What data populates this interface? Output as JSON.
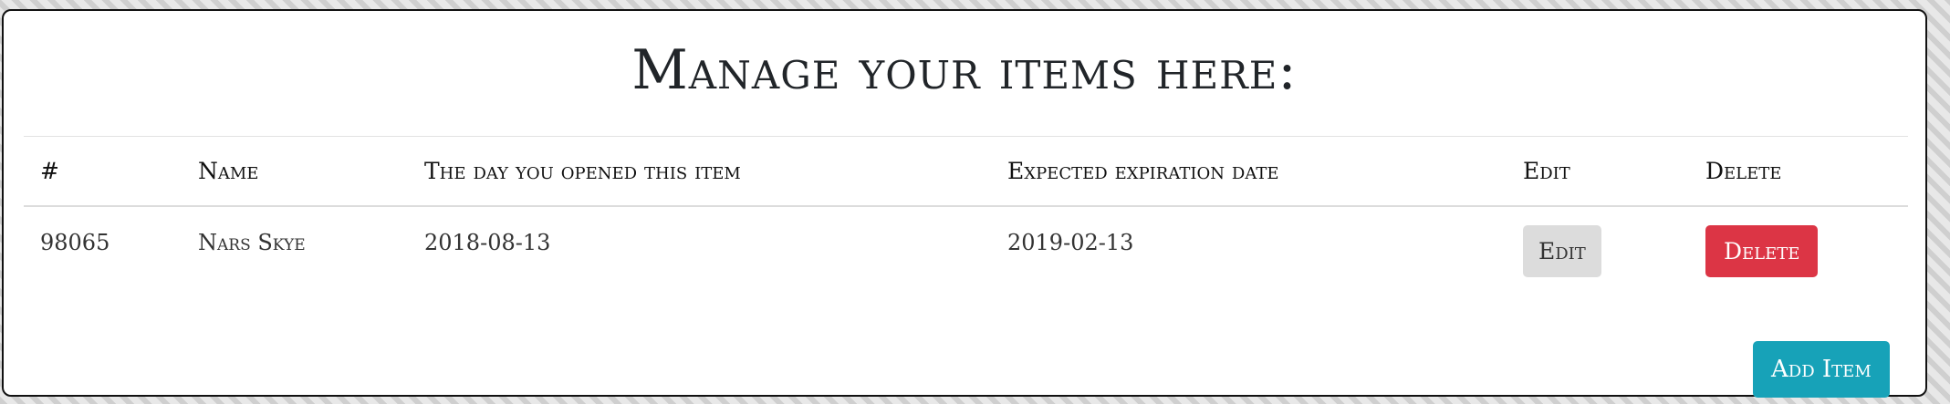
{
  "page_title": "Manage your items here:",
  "table": {
    "headers": [
      "#",
      "Name",
      "The day you opened this item",
      "Expected expiration date",
      "Edit",
      "Delete"
    ],
    "rows": [
      {
        "id": "98065",
        "name": "Nars Skye",
        "opened": "2018-08-13",
        "expires": "2019-02-13",
        "edit_label": "Edit",
        "delete_label": "Delete"
      }
    ]
  },
  "add_button_label": "Add Item",
  "colors": {
    "delete": "#dc3545",
    "add": "#17a2b8",
    "edit": "#dcdcdc"
  }
}
